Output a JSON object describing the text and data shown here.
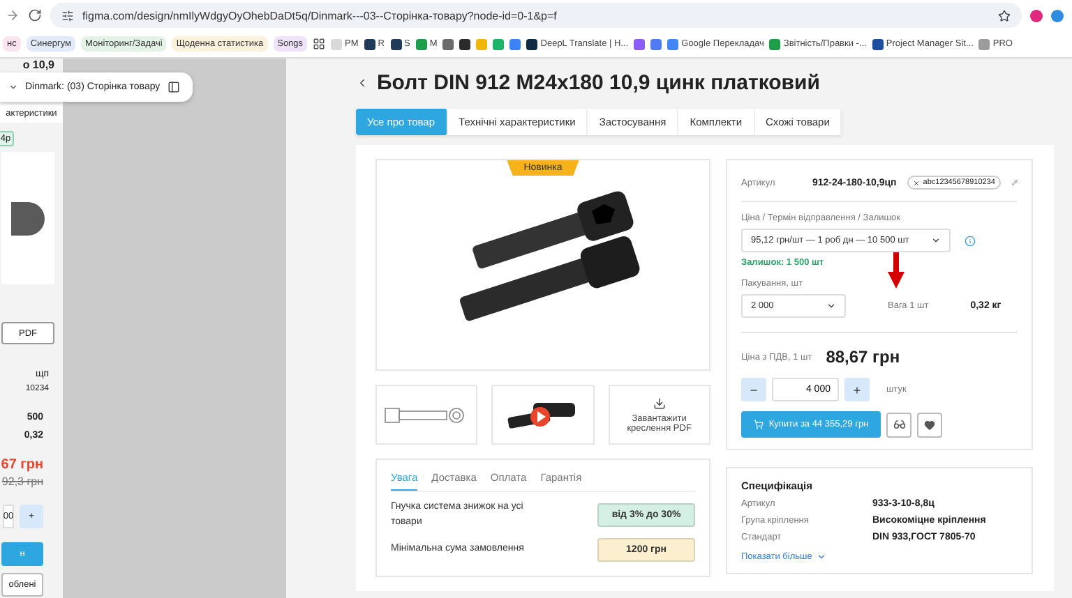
{
  "browser": {
    "address": "figma.com/design/nmIlyWdgyOyOhebDaDt5q/Dinmark---03--Сторінка-товару?node-id=0-1&p=f",
    "bookmarks": [
      {
        "kind": "chip",
        "label": "нс",
        "color": "#fbe3ef"
      },
      {
        "kind": "chip",
        "label": "Синергум",
        "color": "#e3ebfb"
      },
      {
        "kind": "chip",
        "label": "Моніторинг/Задачі",
        "color": "#e3f4e6"
      },
      {
        "kind": "chip",
        "label": "Щоденна статистика",
        "color": "#fbf1dc"
      },
      {
        "kind": "chip",
        "label": "Songs",
        "color": "#efe3fb"
      },
      {
        "kind": "apps"
      },
      {
        "kind": "link",
        "label": "PM",
        "color": "#d9d9d9"
      },
      {
        "kind": "link",
        "label": "R",
        "color": "#1f3b57"
      },
      {
        "kind": "link",
        "label": "S",
        "color": "#1f3b57"
      },
      {
        "kind": "link",
        "label": "M",
        "color": "#1e9e4a"
      },
      {
        "kind": "icon",
        "color": "#6b6b6b"
      },
      {
        "kind": "icon",
        "color": "#2b2b2b"
      },
      {
        "kind": "icon",
        "color": "#f2b705"
      },
      {
        "kind": "icon",
        "color": "#1db46a"
      },
      {
        "kind": "icon",
        "color": "#3b82f6"
      },
      {
        "kind": "link",
        "label": "DeepL Translate | H...",
        "color": "#0f2b46"
      },
      {
        "kind": "icon",
        "color": "#8b5cf6"
      },
      {
        "kind": "icon",
        "color": "#4f7cf0"
      },
      {
        "kind": "link",
        "label": "Google Перекладач",
        "color": "#4285f4"
      },
      {
        "kind": "link",
        "label": "Звітність/Правки -...",
        "color": "#1e9e4a"
      },
      {
        "kind": "link",
        "label": "Project Manager Sit...",
        "color": "#1c4fa0"
      },
      {
        "kind": "link",
        "label": "PRO",
        "color": "#9b9b9b"
      }
    ]
  },
  "figma": {
    "frame_name": "Dinmark: (03) Сторінка товару"
  },
  "mobile_frame": {
    "title": "о 10,9",
    "tab": "актеристики",
    "badge": "4р",
    "pdf_button": "PDF",
    "sku": "щп",
    "sku_tag": "10234",
    "rows": [
      "500",
      "0,32"
    ],
    "price": "67 грн",
    "old_price": "92,3 грн",
    "qty": "00",
    "plus": "+",
    "buy": "н",
    "compare": "облені"
  },
  "product": {
    "title": "Болт DIN 912 M24x180 10,9 цинк платковий",
    "tabs": [
      {
        "label": "Усе про товар",
        "selected": true
      },
      {
        "label": "Технічні характеристики",
        "selected": false
      },
      {
        "label": "Застосування",
        "selected": false
      },
      {
        "label": "Комплекти",
        "selected": false
      },
      {
        "label": "Схожі товари",
        "selected": false
      }
    ],
    "badge": "Новинка",
    "thumbnails": [
      {
        "kind": "drawing"
      },
      {
        "kind": "video"
      },
      {
        "kind": "download",
        "label": "Завантажити креслення PDF"
      }
    ],
    "info_tabs": [
      {
        "label": "Увага",
        "selected": true
      },
      {
        "label": "Доставка",
        "selected": false
      },
      {
        "label": "Оплата",
        "selected": false
      },
      {
        "label": "Гарантія",
        "selected": false
      }
    ],
    "info_rows": [
      {
        "label": "Гнучка система знижок на усі товари",
        "value": "від 3% до 30%",
        "color": "#d4efe4"
      },
      {
        "label": "Мінімальна сума замовлення",
        "value": "1200 грн",
        "color": "#fbefcf"
      }
    ]
  },
  "purchase": {
    "sku_label": "Артикул",
    "sku": "912-24-180-10,9цп",
    "sku_tag": "abc12345678910234",
    "price_label": "Ціна / Термін відправлення / Залишок",
    "price_select": "95,12 грн/шт — 1 роб дн — 10 500 шт",
    "stock": "Залишок:  1 500 шт",
    "pack_label": "Пакування, шт",
    "pack_select": "2 000",
    "weight_label": "Вага 1 шт",
    "weight": "0,32 кг",
    "vat_label": "Ціна з ПДВ, 1 шт",
    "vat_price": "88,67 грн",
    "minus": "−",
    "qty": "4 000",
    "plus": "+",
    "unit": "штук",
    "buy": "Купити за 44 355,29 грн"
  },
  "specification": {
    "title": "Специфікація",
    "rows": [
      {
        "label": "Артикул",
        "value": "933-3-10-8,8ц"
      },
      {
        "label": "Група кріплення",
        "value": "Високоміцне кріплення"
      },
      {
        "label": "Стандарт",
        "value": "DIN 933,ГОСТ 7805-70"
      }
    ],
    "more": "Показати більше"
  }
}
